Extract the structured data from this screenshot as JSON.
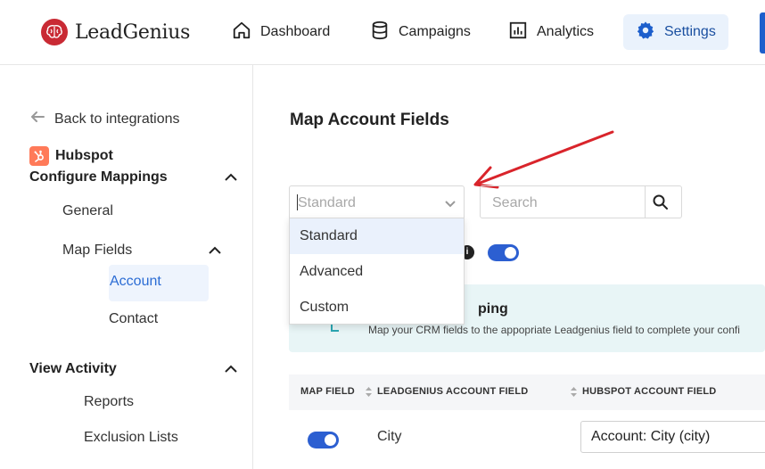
{
  "brand": {
    "name": "LeadGenius"
  },
  "nav": {
    "items": [
      {
        "label": "Dashboard",
        "icon": "home-icon"
      },
      {
        "label": "Campaigns",
        "icon": "database-icon"
      },
      {
        "label": "Analytics",
        "icon": "bar-chart-icon"
      },
      {
        "label": "Settings",
        "icon": "gear-icon",
        "active": true
      }
    ]
  },
  "sidebar": {
    "back_label": "Back to integrations",
    "integration_name": "Hubspot",
    "configure_title": "Configure Mappings",
    "general_label": "General",
    "map_fields_label": "Map Fields",
    "account_label": "Account",
    "contact_label": "Contact",
    "view_activity_title": "View Activity",
    "reports_label": "Reports",
    "exclusion_label": "Exclusion Lists"
  },
  "main": {
    "title": "Map Account Fields",
    "select": {
      "value": "Standard",
      "options": [
        "Standard",
        "Advanced",
        "Custom"
      ],
      "selected_index": 0
    },
    "search": {
      "placeholder": "Search"
    },
    "banner": {
      "title": "ping",
      "text": "Map your CRM fields to the appopriate Leadgenius field to complete your confi"
    },
    "table": {
      "headers": {
        "map_field": "MAP FIELD",
        "lg_field": "LEADGENIUS ACCOUNT FIELD",
        "hs_field": "HUBSPOT ACCOUNT FIELD"
      },
      "rows": [
        {
          "enabled": true,
          "lg_field": "City",
          "hs_field": "Account: City (city)"
        }
      ]
    }
  },
  "colors": {
    "brand_red": "#c92a34",
    "accent_blue": "#2c5fd1",
    "active_nav_bg": "#eaf2fc",
    "annotation_arrow": "#d9242b",
    "banner_bg": "#e8f5f6"
  }
}
